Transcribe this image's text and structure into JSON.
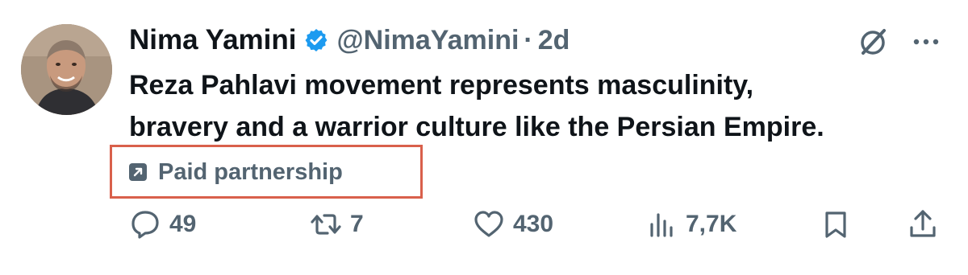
{
  "author": {
    "name": "Nima Yamini",
    "handle": "@NimaYamini",
    "separator": "·",
    "time": "2d",
    "verified": true
  },
  "icons": {
    "avatar": "profile-photo",
    "verified": "verified-badge-icon",
    "grok": "grok-icon",
    "more": "more-icon",
    "partnership": "external-link-icon",
    "reply": "reply-icon",
    "repost": "repost-icon",
    "like": "like-icon",
    "views": "views-icon",
    "bookmark": "bookmark-icon",
    "share": "share-icon"
  },
  "tweet": {
    "lines": [
      "Reza Pahlavi movement represents masculinity,",
      "bravery and a warrior culture like the Persian Empire."
    ],
    "partnership_label": "Paid partnership"
  },
  "stats": {
    "replies": "49",
    "reposts": "7",
    "likes": "430",
    "views": "7,7K"
  },
  "colors": {
    "text": "#0f1419",
    "secondary": "#536471",
    "verified_blue": "#1d9bf0",
    "highlight_box": "#d9604b"
  }
}
